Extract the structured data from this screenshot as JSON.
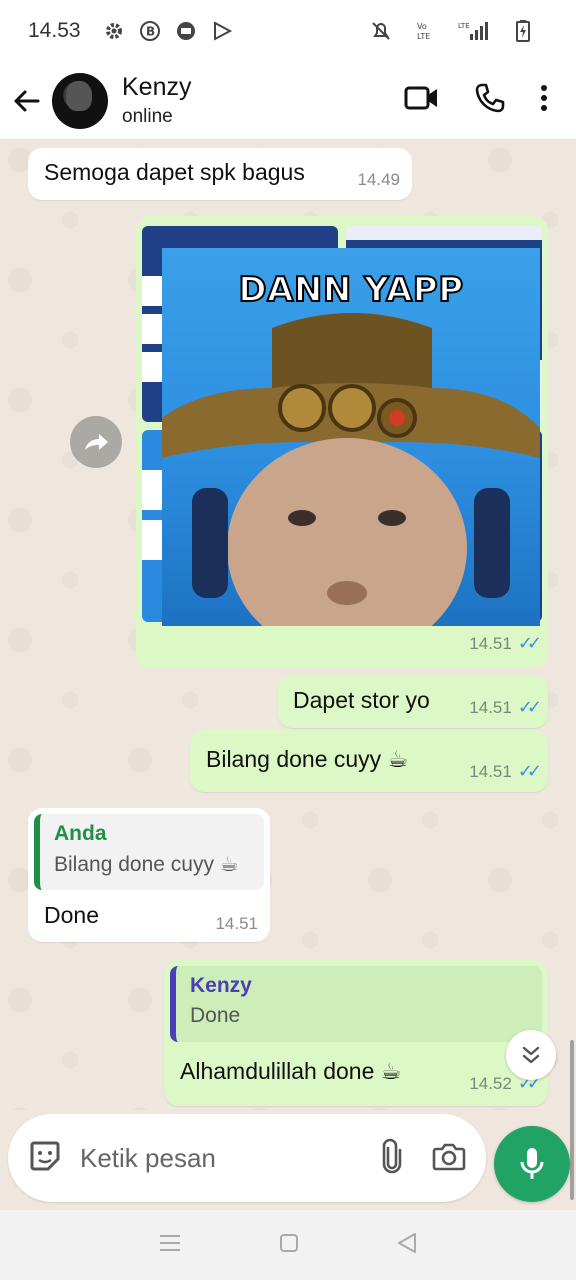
{
  "status_bar": {
    "time": "14.53",
    "icons": [
      "settings-icon",
      "b-app-icon",
      "message-icon",
      "play-icon"
    ],
    "right_icons": [
      "mute-icon",
      "volte-icon",
      "lte-signal-icon",
      "battery-icon"
    ],
    "network_label": "LTE"
  },
  "header": {
    "contact_name": "Kenzy",
    "contact_status": "online",
    "icons": [
      "back-arrow-icon",
      "avatar",
      "video-call-icon",
      "phone-icon",
      "more-vert-icon"
    ]
  },
  "messages": [
    {
      "id": "m1",
      "direction": "in",
      "text": "Semoga dapet spk bagus",
      "time": "14.49"
    },
    {
      "id": "m2",
      "direction": "out",
      "type": "image",
      "caption": "DANN YAPP",
      "time": "14.51",
      "read": true
    },
    {
      "id": "m3",
      "direction": "out",
      "text": "Dapet stor yo",
      "time": "14.51",
      "read": true
    },
    {
      "id": "m4",
      "direction": "out",
      "text": "Bilang done cuyy ☕",
      "time": "14.51",
      "read": true
    },
    {
      "id": "m5",
      "direction": "in",
      "quote_author": "Anda",
      "quote_text": "Bilang done cuyy ☕",
      "text": "Done",
      "time": "14.51"
    },
    {
      "id": "m6",
      "direction": "out",
      "quote_author": "Kenzy",
      "quote_text": "Done",
      "text": "Alhamdulillah done ☕",
      "time": "14.52",
      "read": true
    }
  ],
  "composer": {
    "placeholder": "Ketik pesan",
    "icons": [
      "sticker-icon",
      "attach-icon",
      "camera-icon",
      "mic-icon"
    ]
  },
  "colors": {
    "accent_green": "#21a366",
    "outgoing_bubble": "#dcf8c6",
    "incoming_bubble": "#ffffff",
    "read_ticks": "#3b8ee6",
    "quote_you": "#1f8f4a",
    "quote_other": "#4a3fb5",
    "chat_bg": "#efe7de"
  }
}
